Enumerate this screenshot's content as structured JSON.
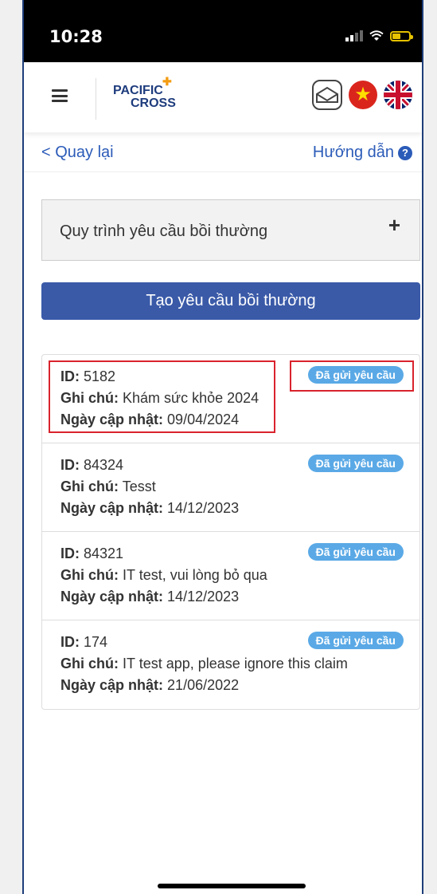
{
  "status_bar": {
    "time": "10:28"
  },
  "header": {
    "logo_line1": "PACIFIC",
    "logo_line2": "CROSS"
  },
  "nav": {
    "back_label": "< Quay lại",
    "guide_label": "Hướng dẫn"
  },
  "accordion": {
    "label": "Quy trình yêu cầu bồi thường",
    "toggle": "+"
  },
  "create_button": {
    "label": "Tạo yêu cầu bồi thường"
  },
  "field_labels": {
    "id": "ID:",
    "note": "Ghi chú:",
    "updated": "Ngày cập nhật:"
  },
  "claims": [
    {
      "id": "5182",
      "note": "Khám sức khỏe 2024",
      "updated": "09/04/2024",
      "status": "Đã gửi yêu cầu"
    },
    {
      "id": "84324",
      "note": "Tesst",
      "updated": "14/12/2023",
      "status": "Đã gửi yêu cầu"
    },
    {
      "id": "84321",
      "note": "IT test, vui lòng bỏ qua",
      "updated": "14/12/2023",
      "status": "Đã gửi yêu cầu"
    },
    {
      "id": "174",
      "note": "IT test app, please ignore this claim",
      "updated": "21/06/2022",
      "status": "Đã gửi yêu cầu"
    }
  ],
  "colors": {
    "brand_blue": "#3a5aa8",
    "link_blue": "#2b5bb8",
    "badge_blue": "#5aa9e6",
    "highlight_red": "#d9232d"
  },
  "icons": [
    "menu-icon",
    "mail-icon",
    "vietnam-flag-icon",
    "uk-flag-icon",
    "help-icon"
  ]
}
